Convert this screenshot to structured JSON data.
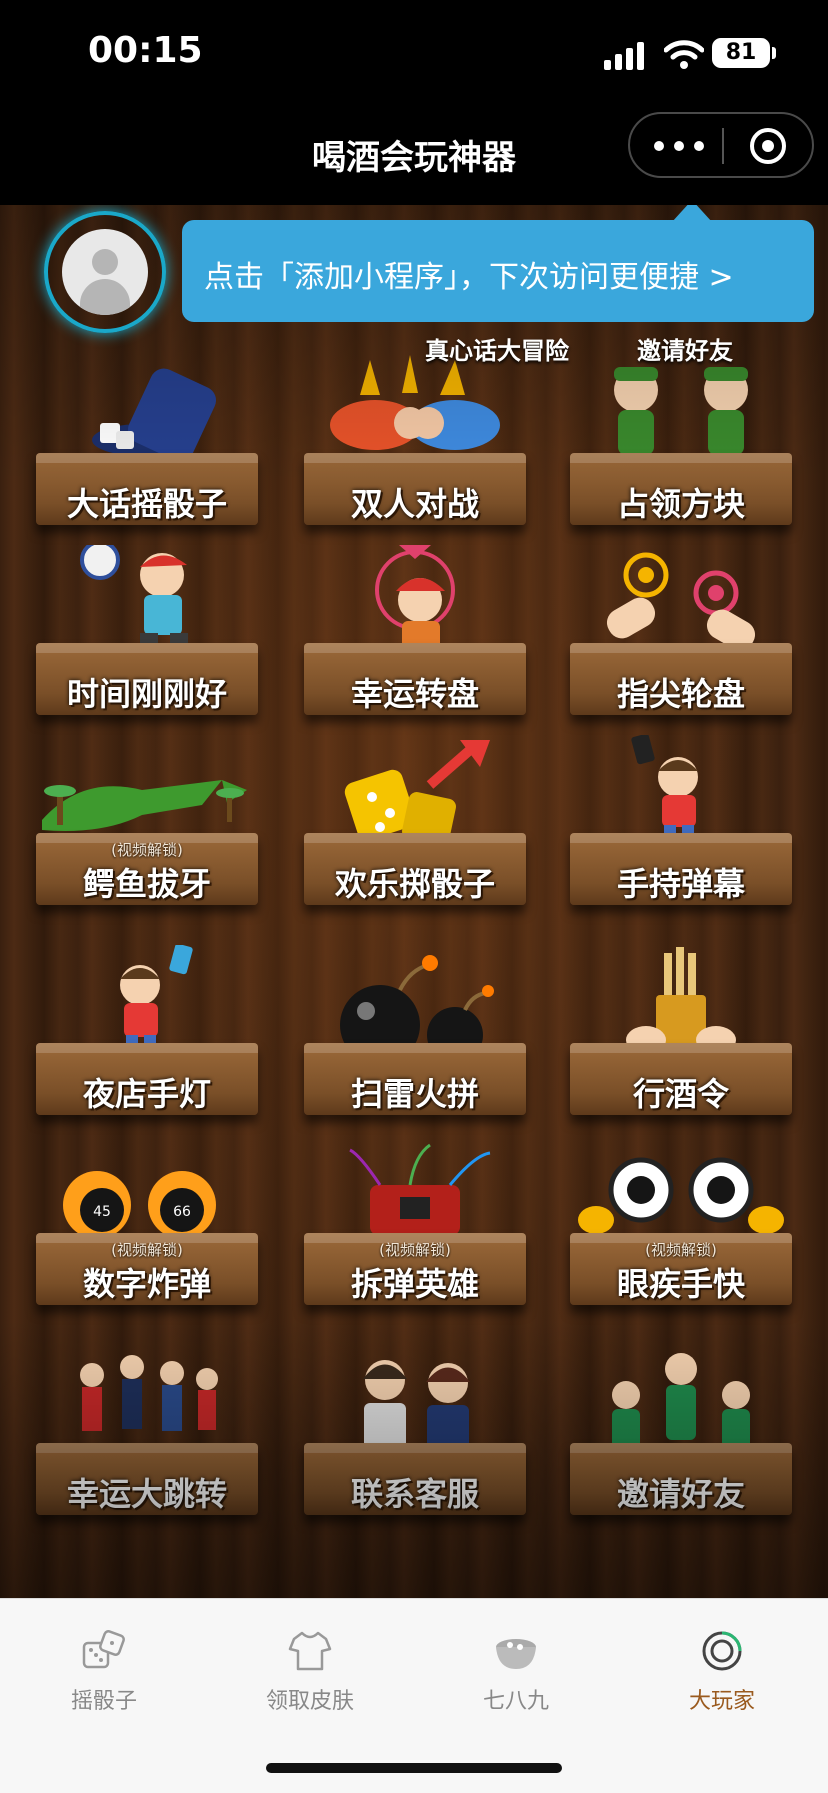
{
  "status": {
    "time": "00:15",
    "battery": "81"
  },
  "nav": {
    "title": "喝酒会玩神器"
  },
  "tooltip": {
    "text": "点击「添加小程序」，下次访问更便捷 >"
  },
  "top_labels": [
    "真心话大冒险",
    "邀请好友"
  ],
  "games": [
    {
      "label": "大话摇骰子",
      "badge": ""
    },
    {
      "label": "双人对战",
      "badge": ""
    },
    {
      "label": "占领方块",
      "badge": ""
    },
    {
      "label": "时间刚刚好",
      "badge": ""
    },
    {
      "label": "幸运转盘",
      "badge": ""
    },
    {
      "label": "指尖轮盘",
      "badge": ""
    },
    {
      "label": "鳄鱼拔牙",
      "badge": "(视频解锁)"
    },
    {
      "label": "欢乐掷骰子",
      "badge": ""
    },
    {
      "label": "手持弹幕",
      "badge": ""
    },
    {
      "label": "夜店手灯",
      "badge": ""
    },
    {
      "label": "扫雷火拼",
      "badge": ""
    },
    {
      "label": "行酒令",
      "badge": ""
    },
    {
      "label": "数字炸弹",
      "badge": "(视频解锁)"
    },
    {
      "label": "拆弹英雄",
      "badge": "(视频解锁)"
    },
    {
      "label": "眼疾手快",
      "badge": "(视频解锁)"
    },
    {
      "label": "幸运大跳转",
      "badge": ""
    },
    {
      "label": "联系客服",
      "badge": ""
    },
    {
      "label": "邀请好友",
      "badge": ""
    }
  ],
  "tabs": [
    {
      "label": "摇骰子",
      "icon": "dice-icon"
    },
    {
      "label": "领取皮肤",
      "icon": "shirt-icon"
    },
    {
      "label": "七八九",
      "icon": "bowl-icon"
    },
    {
      "label": "大玩家",
      "icon": "ring-icon",
      "active": true
    }
  ],
  "colors": {
    "accent": "#3aa7dc",
    "active_tab": "#9a5a1e"
  }
}
